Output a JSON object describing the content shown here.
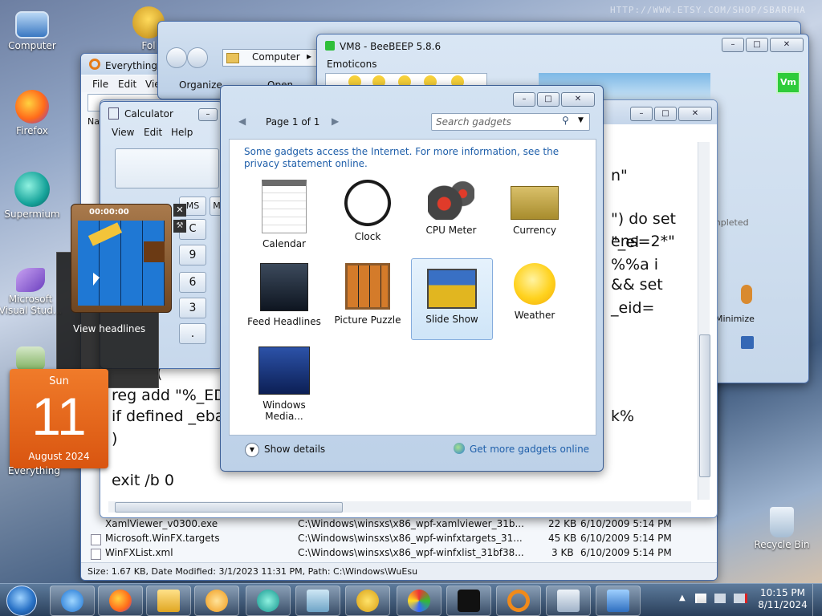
{
  "desktop": {
    "icons": [
      {
        "label": "Computer",
        "icon": "computer-icon"
      },
      {
        "label": "Firefox",
        "icon": "firefox-icon"
      },
      {
        "label": "Supermium",
        "icon": "supermium-icon"
      },
      {
        "label": "Microsoft Visual Stud...",
        "icon": "visual-studio-icon"
      },
      {
        "label": "Everything",
        "icon": "everything-icon"
      },
      {
        "label": "Recycle Bin",
        "icon": "recycle-bin-icon"
      },
      {
        "label": "Fol",
        "icon": "folder-icon"
      }
    ],
    "watermark": "HTTP://WWW.ETSY.COM/SHOP/SBARPHA"
  },
  "calendar_gadget": {
    "weekday": "Sun",
    "day": "11",
    "month_year": "August 2024"
  },
  "puzzle_gadget": {
    "timer": "00:00:00",
    "tooltip": "View headlines"
  },
  "everything_window": {
    "title": "Everything",
    "menu": [
      "File",
      "Edit",
      "Vie"
    ],
    "rows": [
      {
        "name": "XamlViewer_v0300.exe",
        "path": "C:\\Windows\\winsxs\\x86_wpf-xamlviewer_31b...",
        "size": "22 KB",
        "date": "6/10/2009 5:14 PM"
      },
      {
        "name": "Microsoft.WinFX.targets",
        "path": "C:\\Windows\\winsxs\\x86_wpf-winfxtargets_31...",
        "size": "45 KB",
        "date": "6/10/2009 5:14 PM"
      },
      {
        "name": "WinFXList.xml",
        "path": "C:\\Windows\\winsxs\\x86_wpf-winfxlist_31bf38...",
        "size": "3 KB",
        "date": "6/10/2009 5:14 PM"
      }
    ],
    "status": "Size: 1.67 KB, Date Modified: 3/1/2023 11:31 PM, Path: C:\\Windows\\WuEsu"
  },
  "explorer_window": {
    "breadcrumb": "Computer",
    "organize": "Organize",
    "open": "Open"
  },
  "beebeep_window": {
    "title": "VM8 - BeeBEEP 5.8.6",
    "emoticons_label": "Emoticons",
    "badge": "Vm",
    "completed": "mpleted",
    "minimize": "Minimize"
  },
  "calculator_window": {
    "title": "Calculator",
    "menu": [
      "View",
      "Edit",
      "Help"
    ],
    "keys": [
      "MS",
      "M",
      "C",
      "9",
      "6",
      "3",
      "."
    ]
  },
  "editor_window": {
    "lines": [
      "n\"",
      "\") do set \"_el",
      "ens=2*\" %%a i",
      "&& set _eid=",
      "(",
      "reg add \"%_EDT",
      "if defined _eba",
      ")",
      "",
      "exit /b 0"
    ],
    "right_text": "k%"
  },
  "gallery": {
    "page_label": "Page 1 of 1",
    "search_placeholder": "Search gadgets",
    "info_text": "Some gadgets access the Internet.  For more information, see the privacy statement online.",
    "gadgets": [
      {
        "label": "Calendar",
        "icon": "calendar-gadget-icon"
      },
      {
        "label": "Clock",
        "icon": "clock-gadget-icon"
      },
      {
        "label": "CPU Meter",
        "icon": "cpu-meter-gadget-icon"
      },
      {
        "label": "Currency",
        "icon": "currency-gadget-icon"
      },
      {
        "label": "Feed Headlines",
        "icon": "feed-headlines-gadget-icon"
      },
      {
        "label": "Picture Puzzle",
        "icon": "picture-puzzle-gadget-icon"
      },
      {
        "label": "Slide Show",
        "icon": "slide-show-gadget-icon"
      },
      {
        "label": "Weather",
        "icon": "weather-gadget-icon"
      },
      {
        "label": "Windows Media...",
        "icon": "windows-media-gadget-icon"
      }
    ],
    "show_details": "Show details",
    "get_more": "Get more gadgets online"
  },
  "taskbar": {
    "apps": [
      "start-orb-icon",
      "internet-explorer-icon",
      "firefox-icon",
      "explorer-icon",
      "media-player-icon",
      "supermium-icon",
      "notepad-icon",
      "beebeep-icon",
      "paint-icon",
      "lock-icon",
      "everything-search-icon",
      "calculator-icon",
      "remote-desktop-icon"
    ],
    "time": "10:15 PM",
    "date": "8/11/2024"
  },
  "colors": {
    "accent": "#2a66b8",
    "link": "#1f5faa",
    "calendar_orange": "#e8661a",
    "selection": "#cfe5f8"
  }
}
